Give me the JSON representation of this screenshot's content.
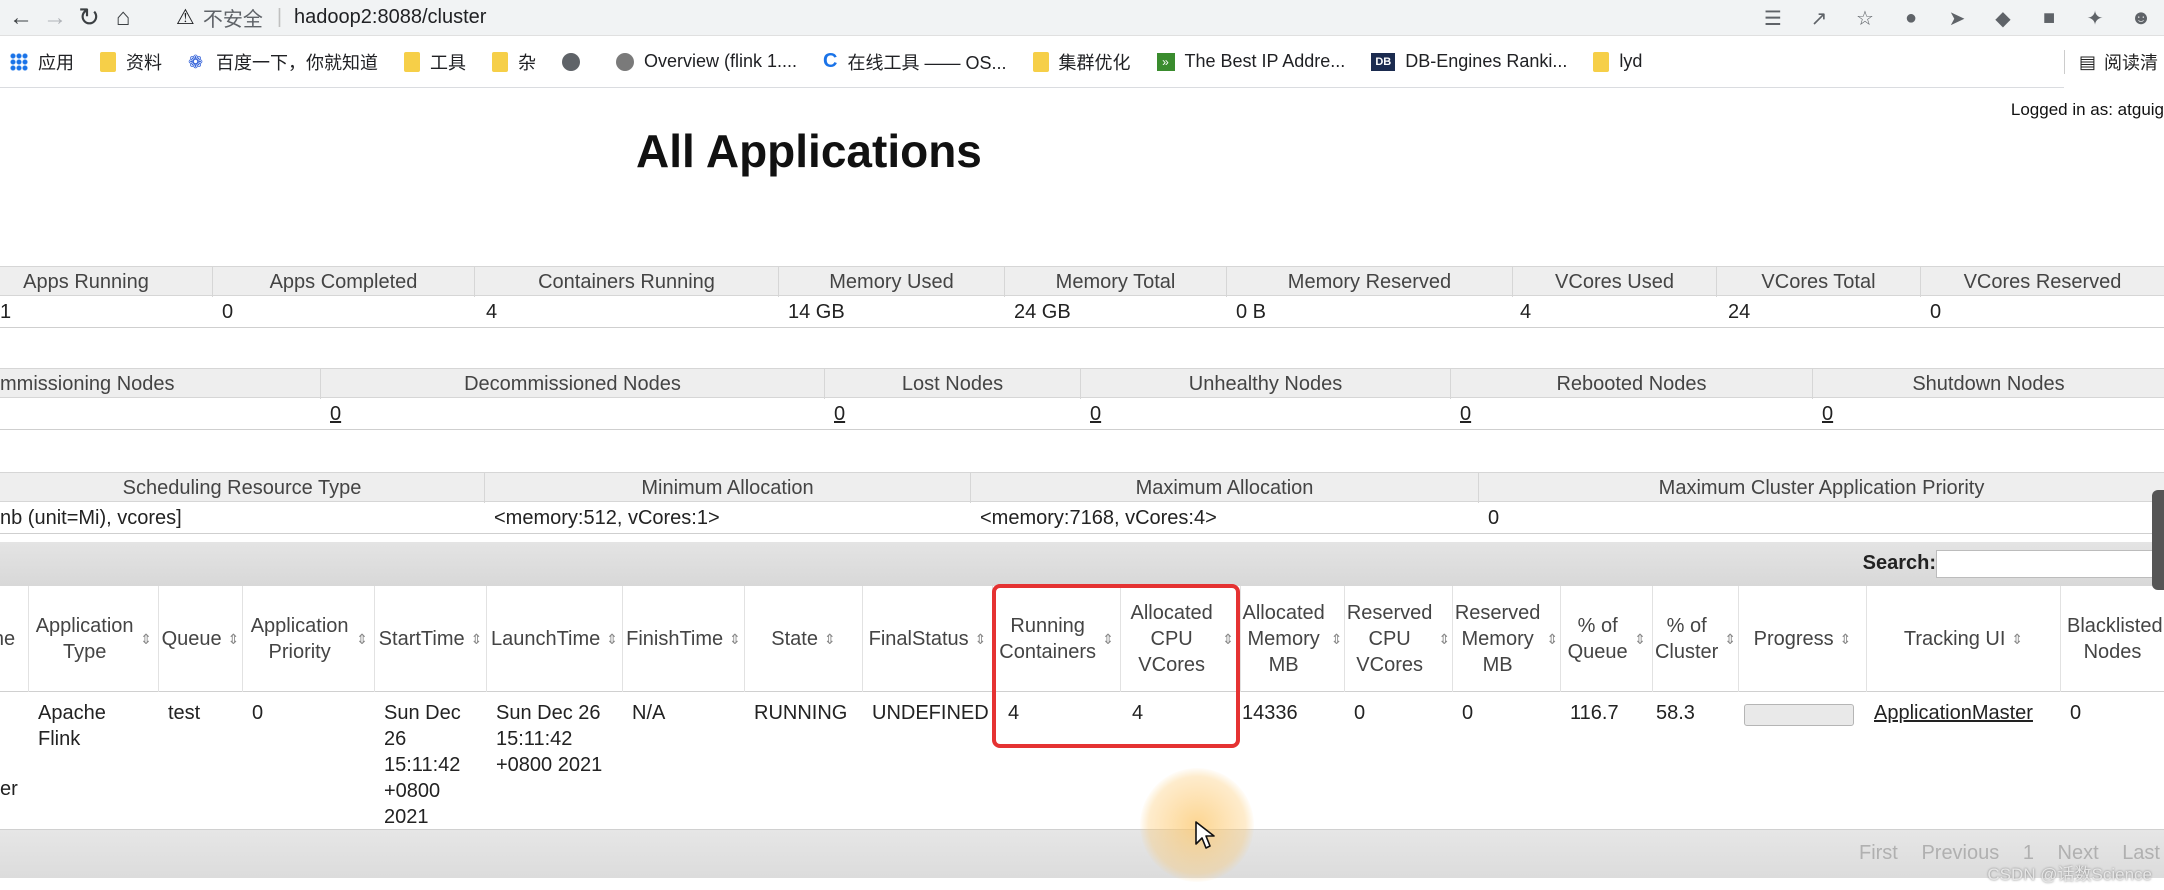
{
  "browser": {
    "security_label": "不安全",
    "url": "hadoop2:8088/cluster",
    "bookmarks": [
      {
        "label": "应用",
        "icon": "apps-grid-icon"
      },
      {
        "label": "资料",
        "icon": "folder-icon"
      },
      {
        "label": "百度一下，你就知道",
        "icon": "baidu-paw-icon"
      },
      {
        "label": "工具",
        "icon": "folder-icon"
      },
      {
        "label": "杂",
        "icon": "folder-icon"
      },
      {
        "label": "",
        "icon": "globe-icon"
      },
      {
        "label": "Overview (flink 1....",
        "icon": "flink-icon"
      },
      {
        "label": "在线工具 —— OS...",
        "icon": "c-logo-icon"
      },
      {
        "label": "集群优化",
        "icon": "folder-icon"
      },
      {
        "label": "The Best IP Addre...",
        "icon": "ip-icon"
      },
      {
        "label": "DB-Engines Ranki...",
        "icon": "db-engines-icon"
      },
      {
        "label": "lyd",
        "icon": "folder-icon"
      }
    ],
    "reader_label": "阅读清"
  },
  "page": {
    "logged_in": "Logged in as: atguig",
    "title": "All Applications"
  },
  "cluster_metrics": {
    "headers": [
      "Apps Running",
      "Apps Completed",
      "Containers Running",
      "Memory Used",
      "Memory Total",
      "Memory Reserved",
      "VCores Used",
      "VCores Total",
      "VCores Reserved"
    ],
    "values": [
      "1",
      "0",
      "4",
      "14 GB",
      "24 GB",
      "0 B",
      "4",
      "24",
      "0"
    ]
  },
  "node_metrics": {
    "headers": [
      "mmissioning Nodes",
      "Decommissioned Nodes",
      "Lost Nodes",
      "Unhealthy Nodes",
      "Rebooted Nodes",
      "Shutdown Nodes"
    ],
    "values": [
      "0",
      "0",
      "0",
      "0",
      "0"
    ]
  },
  "scheduler": {
    "headers": [
      "Scheduling Resource Type",
      "Minimum Allocation",
      "Maximum Allocation",
      "Maximum Cluster Application Priority"
    ],
    "values": [
      "nb (unit=Mi), vcores]",
      "<memory:512, vCores:1>",
      "<memory:7168, vCores:4>",
      "0"
    ]
  },
  "apps_table": {
    "search_label": "Search:",
    "search_value": "",
    "columns": [
      "ne",
      "Application Type",
      "Queue",
      "Application Priority",
      "StartTime",
      "LaunchTime",
      "FinishTime",
      "State",
      "FinalStatus",
      "Running Containers",
      "Allocated CPU VCores",
      "Allocated Memory MB",
      "Reserved CPU VCores",
      "Reserved Memory MB",
      "% of Queue",
      "% of Cluster",
      "Progress",
      "Tracking UI",
      "Blacklisted Nodes"
    ],
    "row": {
      "name": "er",
      "type": "Apache Flink",
      "queue": "test",
      "priority": "0",
      "start": "Sun Dec 26 15:11:42 +0800 2021",
      "launch": "Sun Dec 26 15:11:42 +0800 2021",
      "finish": "N/A",
      "state": "RUNNING",
      "final_status": "UNDEFINED",
      "running_containers": "4",
      "allocated_vcores": "4",
      "allocated_memory": "14336",
      "reserved_vcores": "0",
      "reserved_memory": "0",
      "pct_queue": "116.7",
      "pct_cluster": "58.3",
      "progress_fraction": 0,
      "tracking_ui": "ApplicationMaster",
      "blacklisted": "0"
    },
    "pager": [
      "First",
      "Previous",
      "1",
      "Next",
      "Last"
    ]
  },
  "watermark": "CSDN @话数Science",
  "colors": {
    "highlight": "#e53232",
    "header_band": "#eeeeee"
  }
}
